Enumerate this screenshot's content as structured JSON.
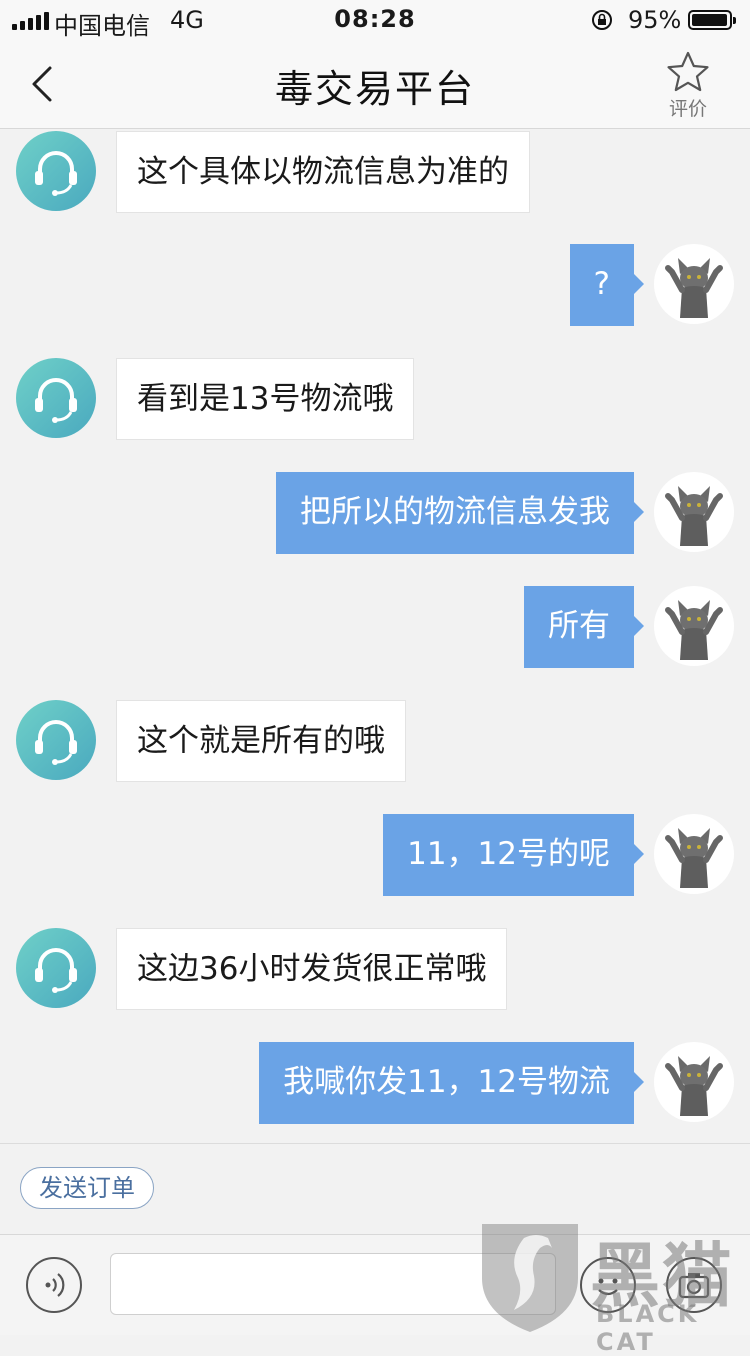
{
  "status_bar": {
    "carrier": "中国电信",
    "network": "4G",
    "time": "08:28",
    "battery": "95%"
  },
  "nav": {
    "title": "毒交易平台",
    "rate_label": "评价"
  },
  "messages": [
    {
      "from": "agent",
      "text": "这个具体以物流信息为准的"
    },
    {
      "from": "user",
      "text": "?"
    },
    {
      "from": "agent",
      "text": "看到是13号物流哦"
    },
    {
      "from": "user",
      "text": "把所以的物流信息发我"
    },
    {
      "from": "user",
      "text": "所有"
    },
    {
      "from": "agent",
      "text": "这个就是所有的哦"
    },
    {
      "from": "user",
      "text": "11，12号的呢"
    },
    {
      "from": "agent",
      "text": "这边36小时发货很正常哦"
    },
    {
      "from": "user",
      "text": "我喊你发11，12号物流"
    }
  ],
  "order_button": "发送订单",
  "input": {
    "placeholder": ""
  },
  "watermark": {
    "cn": "黑猫",
    "en": "BLACK CAT"
  },
  "colors": {
    "user_bubble": "#6aa3e6",
    "agent_avatar": "#4aa9bf",
    "background": "#f2f2f2"
  },
  "icons": [
    "back-chevron-icon",
    "star-icon",
    "headset-icon",
    "cat-avatar-icon",
    "voice-icon",
    "emoji-icon",
    "camera-icon"
  ]
}
